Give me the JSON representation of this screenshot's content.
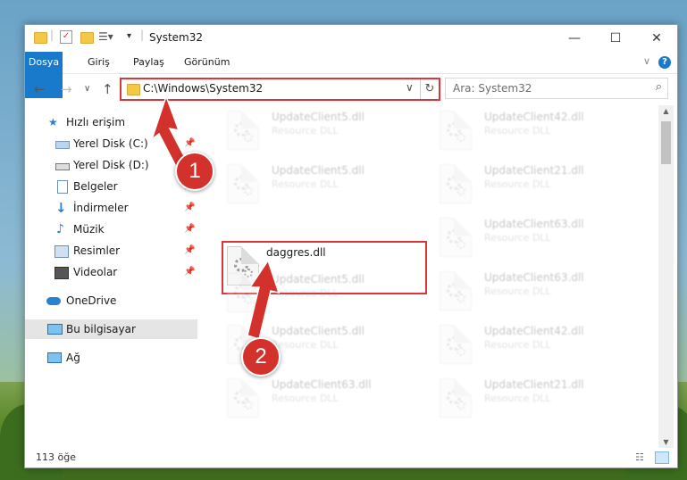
{
  "window": {
    "title": "System32",
    "controls": {
      "minimize": "—",
      "maximize": "☐",
      "close": "✕"
    }
  },
  "ribbon": {
    "tabs": [
      "Dosya",
      "Giriş",
      "Paylaş",
      "Görünüm"
    ]
  },
  "address": {
    "path": "C:\\Windows\\System32",
    "search_placeholder": "Ara: System32"
  },
  "nav_pane": {
    "items": [
      {
        "label": "Hızlı erişim",
        "icon": "star-icon"
      },
      {
        "label": "Yerel Disk (C:)",
        "icon": "drive-icon",
        "pinned": true
      },
      {
        "label": "Yerel Disk (D:)",
        "icon": "drive-icon"
      },
      {
        "label": "Belgeler",
        "icon": "document-icon",
        "pinned": true
      },
      {
        "label": "İndirmeler",
        "icon": "download-icon",
        "pinned": true
      },
      {
        "label": "Müzik",
        "icon": "music-icon",
        "pinned": true
      },
      {
        "label": "Resimler",
        "icon": "picture-icon",
        "pinned": true
      },
      {
        "label": "Videolar",
        "icon": "video-icon",
        "pinned": true
      },
      {
        "label": "OneDrive",
        "icon": "cloud-icon"
      },
      {
        "label": "Bu bilgisayar",
        "icon": "computer-icon",
        "selected": true
      },
      {
        "label": "Ağ",
        "icon": "network-icon"
      }
    ]
  },
  "files": [
    {
      "name": "UpdateClient5.dll",
      "type": "Resource DLL"
    },
    {
      "name": "UpdateClient42.dll",
      "type": "Resource DLL"
    },
    {
      "name": "UpdateClient5.dll",
      "type": "Resource DLL"
    },
    {
      "name": "UpdateClient21.dll",
      "type": "Resource DLL"
    },
    {
      "name": "daggres.dll",
      "type": ""
    },
    {
      "name": "UpdateClient63.dll",
      "type": "Resource DLL"
    },
    {
      "name": "UpdateClient5.dll",
      "type": "Resource DLL"
    },
    {
      "name": "UpdateClient63.dll",
      "type": "Resource DLL"
    },
    {
      "name": "UpdateClient5.dll",
      "type": "Resource DLL"
    },
    {
      "name": "UpdateClient42.dll",
      "type": "Resource DLL"
    },
    {
      "name": "UpdateClient63.dll",
      "type": "Resource DLL"
    },
    {
      "name": "UpdateClient21.dll",
      "type": "Resource DLL"
    }
  ],
  "status": {
    "item_count": "113 öğe"
  },
  "annotations": {
    "step1": "1",
    "step2": "2",
    "color": "#d3312c"
  }
}
